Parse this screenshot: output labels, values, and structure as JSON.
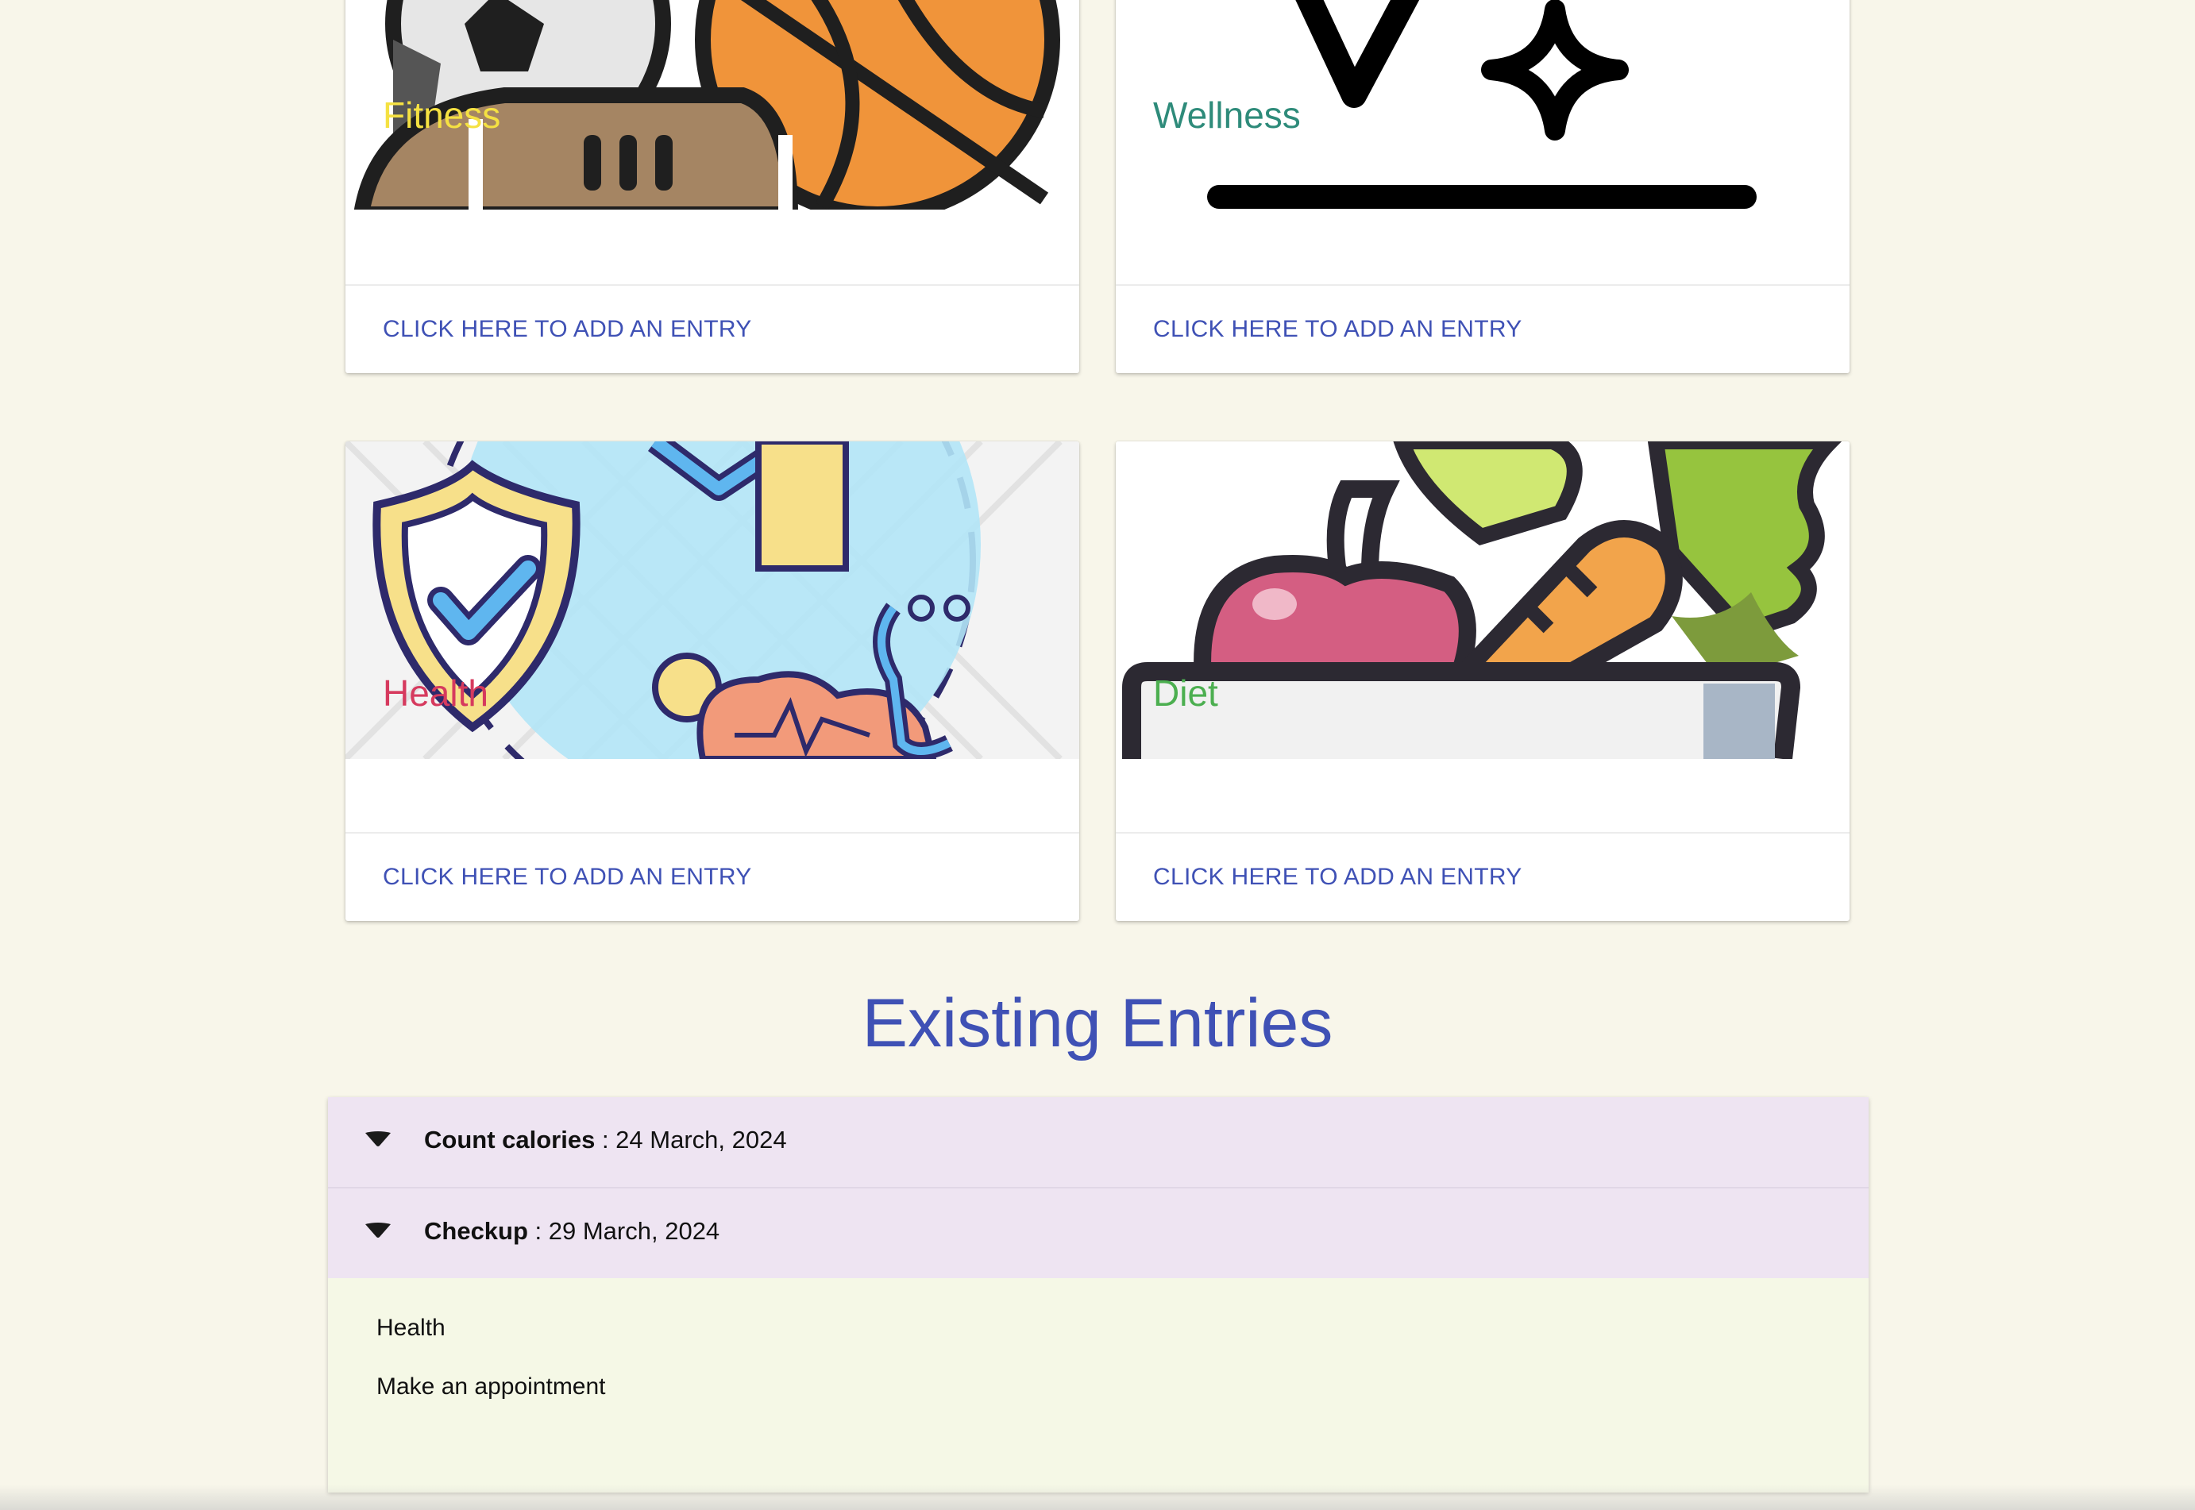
{
  "cards": [
    {
      "title": "Fitness",
      "title_color": "#f5e142",
      "action_label": "CLICK HERE TO ADD AN ENTRY",
      "icon": "sports-balls-icon"
    },
    {
      "title": "Wellness",
      "title_color": "#2e8b7a",
      "action_label": "CLICK HERE TO ADD AN ENTRY",
      "icon": "sparkles-icon"
    },
    {
      "title": "Health",
      "title_color": "#d63a5e",
      "action_label": "CLICK HERE TO ADD AN ENTRY",
      "icon": "health-shield-icon"
    },
    {
      "title": "Diet",
      "title_color": "#4caf50",
      "action_label": "CLICK HERE TO ADD AN ENTRY",
      "icon": "food-bowl-icon"
    }
  ],
  "entries_section": {
    "title": "Existing Entries",
    "entries": [
      {
        "name": "Count calories",
        "date_text": " : 24 March, 2024"
      },
      {
        "name": "Checkup",
        "date_text": " : 29 March, 2024",
        "category": "Health",
        "description": "Make an appointment"
      }
    ]
  },
  "colors": {
    "accent": "#3f51b5",
    "page_background": "#f8f6ea",
    "accordion_header": "#eee4f2",
    "accordion_body": "#f5f8e6"
  }
}
